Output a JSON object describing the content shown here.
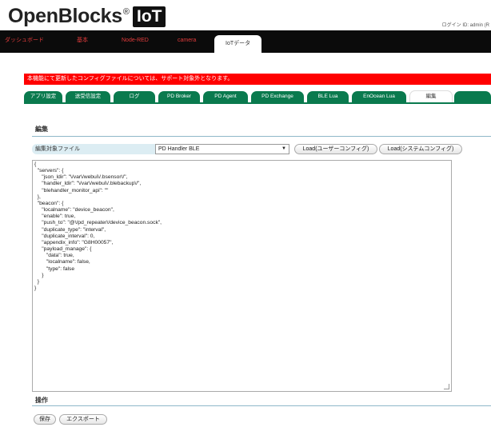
{
  "header": {
    "logo_text": "OpenBlocks",
    "logo_reg": "®",
    "logo_badge": "IoT",
    "login_text": "ログイン ID: admin (R"
  },
  "nav": {
    "items": [
      {
        "label": "ダッシュボード"
      },
      {
        "label": "基本"
      },
      {
        "label": "Node-RED"
      },
      {
        "label": "camera"
      },
      {
        "label": "IoTデータ"
      }
    ],
    "active_index": 4
  },
  "warning": {
    "text": "本機能にて更新したコンフィグファイルについては、サポート対象外となります。"
  },
  "tabs": {
    "items": [
      {
        "label": "アプリ設定"
      },
      {
        "label": "送受信設定"
      },
      {
        "label": "ログ"
      },
      {
        "label": "PD Broker"
      },
      {
        "label": "PD Agent"
      },
      {
        "label": "PD Exchange"
      },
      {
        "label": "BLE Lua"
      },
      {
        "label": "EnOcean Lua"
      },
      {
        "label": "編集"
      }
    ],
    "active_index": 8
  },
  "edit_section": {
    "title": "編集",
    "file_label": "編集対象ファイル",
    "file_selected": "PD Handler BLE",
    "load_user_label": "Load(ユーザーコンフィグ)",
    "load_system_label": "Load(システムコンフィグ)",
    "editor_content": "{\n  \"servers\": {\n     \"json_ldir\": \"\\/var\\/webui\\/.bsensor\\/\",\n     \"handler_ldir\": \"\\/var\\/webui\\/.blebackup\\/\",\n     \"blehandler_monitor_api\": \"\"\n  },\n  \"beacon\": {\n     \"localname\": \"device_beacon\",\n     \"enable\": true,\n     \"push_to\": \"@\\/pd_repeater\\/device_beacon.sock\",\n     \"duplicate_type\": \"interval\",\n     \"duplicate_interval\": 0,\n     \"appendix_info\": \"G8H00057\",\n     \"payload_manage\": {\n        \"data\": true,\n        \"localname\": false,\n        \"type\": false\n     }\n  }\n}"
  },
  "ops_section": {
    "title": "操作",
    "save_label": "保存",
    "export_label": "エクスポート"
  },
  "colors": {
    "nav_bg": "#0b0b0b",
    "nav_text": "#e23b3b",
    "warning_bg": "#ff0000",
    "tab_bg": "#0a7a4e",
    "section_rule": "#8fb8c9",
    "file_label_bg": "#dcedf3"
  }
}
